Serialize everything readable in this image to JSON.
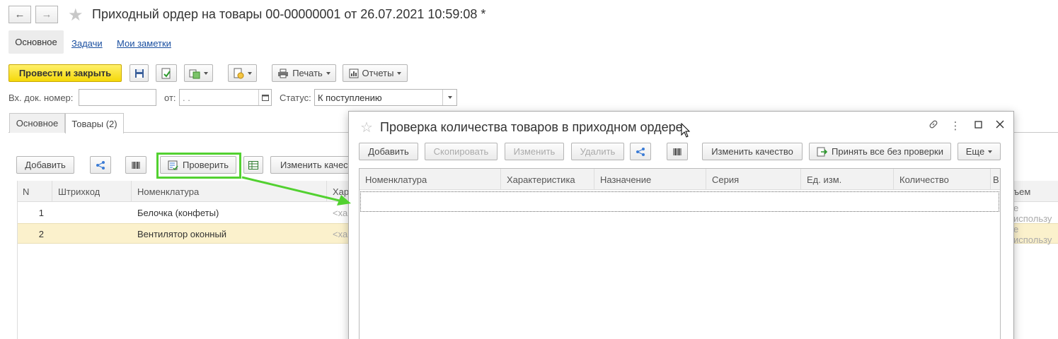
{
  "window": {
    "title": "Приходный ордер на товары 00-00000001 от 26.07.2021 10:59:08 *",
    "back_icon": "arrow-left-icon",
    "forward_icon": "arrow-right-icon",
    "favorite_icon": "star-icon"
  },
  "sections": {
    "main": "Основное",
    "tasks": "Задачи",
    "notes": "Мои заметки"
  },
  "toolbar": {
    "post_close": "Провести и закрыть",
    "print": "Печать",
    "reports": "Отчеты"
  },
  "fields": {
    "in_doc_label": "Вх. док. номер:",
    "in_doc_value": "",
    "date_label": "от:",
    "date_value": " .  .",
    "status_label": "Статус:",
    "status_value": "К поступлению"
  },
  "tabs": [
    "Основное",
    "Товары (2)"
  ],
  "goods_toolbar": {
    "add": "Добавить",
    "check": "Проверить",
    "change_quality": "Изменить качест"
  },
  "goods_table": {
    "columns": [
      "N",
      "Штрихкод",
      "Номенклатура",
      "Хар"
    ],
    "right_col_header": "ъем",
    "rows": [
      {
        "n": "1",
        "barcode": "",
        "item": "Белочка (конфеты)",
        "char": "<ха",
        "tail": "е использу"
      },
      {
        "n": "2",
        "barcode": "",
        "item": "Вентилятор оконный",
        "char": "<ха",
        "tail": "е использу"
      }
    ]
  },
  "dialog": {
    "title": "Проверка количества товаров в приходном ордере",
    "buttons": {
      "add": "Добавить",
      "copy": "Скопировать",
      "edit": "Изменить",
      "delete": "Удалить",
      "change_quality": "Изменить качество",
      "accept_all": "Принять все без проверки",
      "more": "Еще"
    },
    "columns": [
      "Номенклатура",
      "Характеристика",
      "Назначение",
      "Серия",
      "Ед. изм.",
      "Количество",
      "В"
    ]
  },
  "colors": {
    "primary_button": "#f5d90a",
    "highlight": "#52d130",
    "selected_row": "#fbf1cc",
    "link": "#1a4fa0"
  }
}
